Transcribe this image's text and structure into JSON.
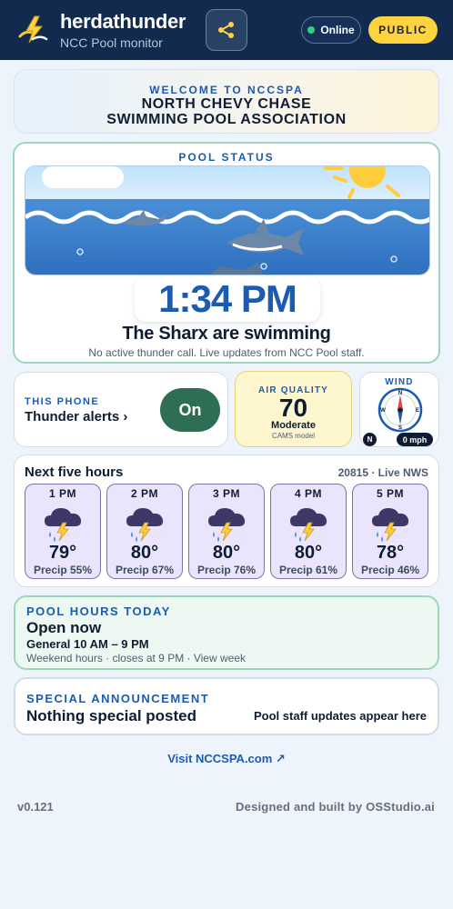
{
  "header": {
    "title": "herdathunder",
    "subtitle": "NCC Pool monitor",
    "online_label": "Online",
    "public_label": "PUBLIC",
    "colors": {
      "background": "#112a4d",
      "online_dot": "#35d07f",
      "public_pill": "#ffd23f"
    }
  },
  "welcome": {
    "kicker": "WELCOME TO NCCSPA",
    "line1": "NORTH CHEVY CHASE",
    "line2": "SWIMMING POOL ASSOCIATION"
  },
  "pool_status": {
    "title": "POOL STATUS",
    "time": "1:34 PM",
    "status": "The Sharx are swimming",
    "note": "No active thunder call. Live updates from NCC Pool staff."
  },
  "phone_alerts": {
    "kicker": "THIS PHONE",
    "label": "Thunder alerts ›",
    "toggle_label": "On"
  },
  "air_quality": {
    "kicker": "AIR QUALITY",
    "value": "70",
    "level": "Moderate",
    "model": "CAMS model"
  },
  "wind": {
    "title": "WIND",
    "direction": "N",
    "speed": "0 mph",
    "compass_labels": {
      "n": "N",
      "e": "E",
      "s": "S",
      "w": "W"
    }
  },
  "forecast": {
    "title": "Next five hours",
    "location": "20815 · Live NWS",
    "icon": "thunderstorm-icon",
    "hours": [
      {
        "time": "1 PM",
        "temp": "79°",
        "precip": "Precip 55%"
      },
      {
        "time": "2 PM",
        "temp": "80°",
        "precip": "Precip 67%"
      },
      {
        "time": "3 PM",
        "temp": "80°",
        "precip": "Precip 76%"
      },
      {
        "time": "4 PM",
        "temp": "80°",
        "precip": "Precip 61%"
      },
      {
        "time": "5 PM",
        "temp": "78°",
        "precip": "Precip 46%"
      }
    ]
  },
  "pool_hours": {
    "kicker": "POOL HOURS TODAY",
    "state": "Open now",
    "general": "General 10 AM – 9 PM",
    "note": "Weekend hours · closes at 9 PM · View week"
  },
  "announcement": {
    "kicker": "SPECIAL ANNOUNCEMENT",
    "body": "Nothing special posted",
    "side": "Pool staff updates appear here"
  },
  "footer": {
    "visit_link": "Visit NCCSPA.com ↗",
    "version": "v0.121",
    "credit": "Designed and built by OSStudio.ai"
  }
}
